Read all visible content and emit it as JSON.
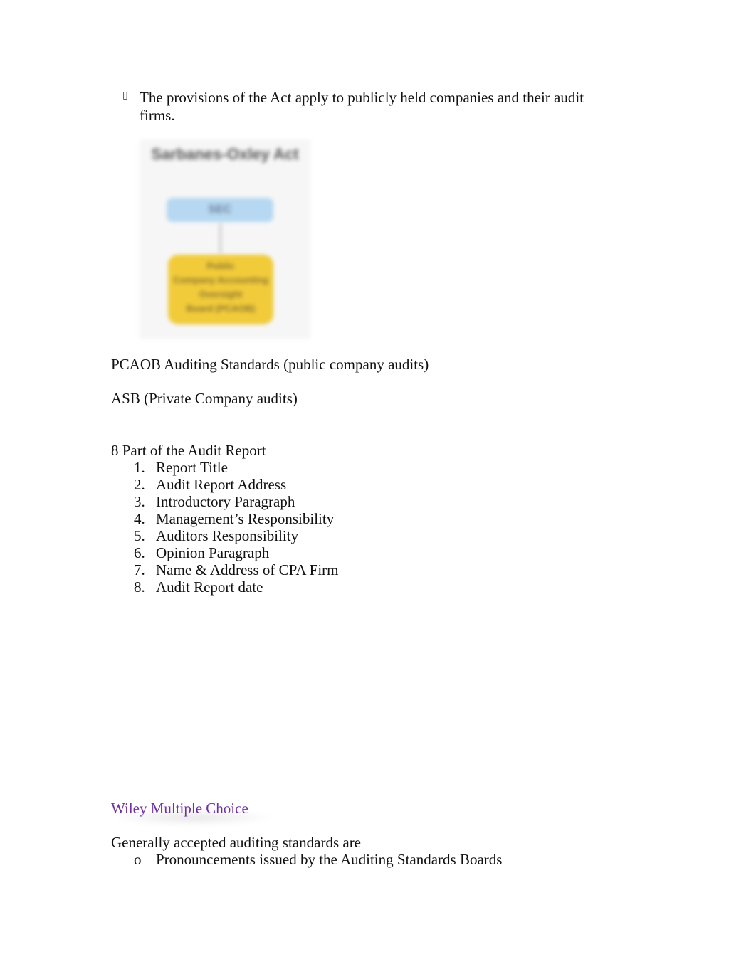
{
  "bullet_section": {
    "bullet_icon": "wingdings-bullet-icon",
    "text": "The provisions of the Act apply to publicly held companies and their audit firms."
  },
  "diagram": {
    "title": "Sarbanes-Oxley Act",
    "top_box": "SEC",
    "bottom_box_lines": [
      "Public",
      "Company Accounting",
      "Oversight",
      "Board (PCAOB)"
    ],
    "colors": {
      "top_box": "#b6d8f2",
      "bottom_box": "#f1cb3a"
    }
  },
  "paragraphs": {
    "pcaob": "PCAOB Auditing Standards (public company audits)",
    "asb": "ASB (Private Company audits)"
  },
  "audit_report": {
    "heading": "8 Part of the Audit Report",
    "items": [
      {
        "num": "1.",
        "text": "Report Title"
      },
      {
        "num": "2.",
        "text": "Audit Report Address"
      },
      {
        "num": "3.",
        "text": "Introductory Paragraph"
      },
      {
        "num": "4.",
        "text": "Management’s Responsibility"
      },
      {
        "num": "5.",
        "text": "Auditors Responsibility"
      },
      {
        "num": "6.",
        "text": "Opinion Paragraph"
      },
      {
        "num": "7.",
        "text": "Name & Address of CPA Firm"
      },
      {
        "num": "8.",
        "text": "Audit Report date"
      }
    ]
  },
  "wiley": {
    "heading": "Wiley Multiple Choice",
    "heading_color": "#7030a0",
    "question": "Generally accepted auditing standards are",
    "options": [
      {
        "marker": "o",
        "text": "Pronouncements issued by the Auditing Standards Boards"
      }
    ]
  }
}
